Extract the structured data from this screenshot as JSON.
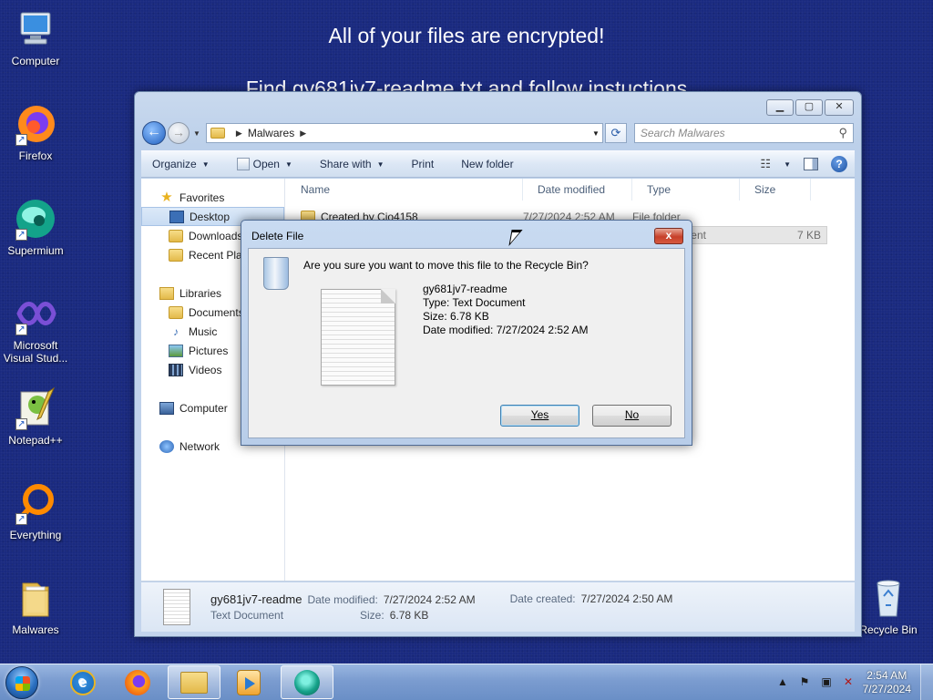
{
  "desktop": {
    "ransom_text": {
      "line1": "All of your files are encrypted!",
      "line2": "Find gy681jv7-readme.txt and follow instuctions"
    },
    "icons": [
      {
        "label": "Computer",
        "icon": "computer-icon"
      },
      {
        "label": "Firefox",
        "icon": "firefox-icon"
      },
      {
        "label": "Supermium",
        "icon": "supermium-icon"
      },
      {
        "label": "Microsoft Visual Stud...",
        "icon": "visual-studio-icon"
      },
      {
        "label": "Notepad++",
        "icon": "notepadpp-icon"
      },
      {
        "label": "Everything",
        "icon": "everything-icon"
      },
      {
        "label": "Malwares",
        "icon": "folder-icon"
      },
      {
        "label": "Recycle Bin",
        "icon": "recycle-bin-icon"
      }
    ]
  },
  "explorer": {
    "address": {
      "segments": [
        "Malwares"
      ]
    },
    "search": {
      "placeholder": "Search Malwares"
    },
    "toolbar": {
      "organize": "Organize",
      "open": "Open",
      "share_with": "Share with",
      "print": "Print",
      "new_folder": "New folder"
    },
    "nav": {
      "favorites": "Favorites",
      "desktop": "Desktop",
      "downloads": "Downloads",
      "recent_places": "Recent Plac",
      "libraries": "Libraries",
      "documents": "Documents",
      "music": "Music",
      "pictures": "Pictures",
      "videos": "Videos",
      "computer": "Computer",
      "network": "Network"
    },
    "columns": {
      "name": "Name",
      "date_modified": "Date modified",
      "type": "Type",
      "size": "Size"
    },
    "files": [
      {
        "name": "Created by Cio4158",
        "date": "7/27/2024 2:52 AM",
        "type": "File folder",
        "size": ""
      },
      {
        "name": "",
        "date": "",
        "type": "ument",
        "size": "7 KB"
      }
    ],
    "details": {
      "name": "gy681jv7-readme",
      "kind": "Text Document",
      "date_modified_label": "Date modified:",
      "date_modified": "7/27/2024 2:52 AM",
      "date_created_label": "Date created:",
      "date_created": "7/27/2024 2:50 AM",
      "size_label": "Size:",
      "size": "6.78 KB"
    }
  },
  "dialog": {
    "title": "Delete File",
    "close": "x",
    "question": "Are you sure you want to move this file to the Recycle Bin?",
    "file_name": "gy681jv7-readme",
    "file_type": "Type: Text Document",
    "file_size": "Size: 6.78 KB",
    "file_date": "Date modified: 7/27/2024 2:52 AM",
    "yes_label": "Yes",
    "no_label": "No"
  },
  "taskbar": {
    "clock_time": "2:54 AM",
    "clock_date": "7/27/2024"
  }
}
